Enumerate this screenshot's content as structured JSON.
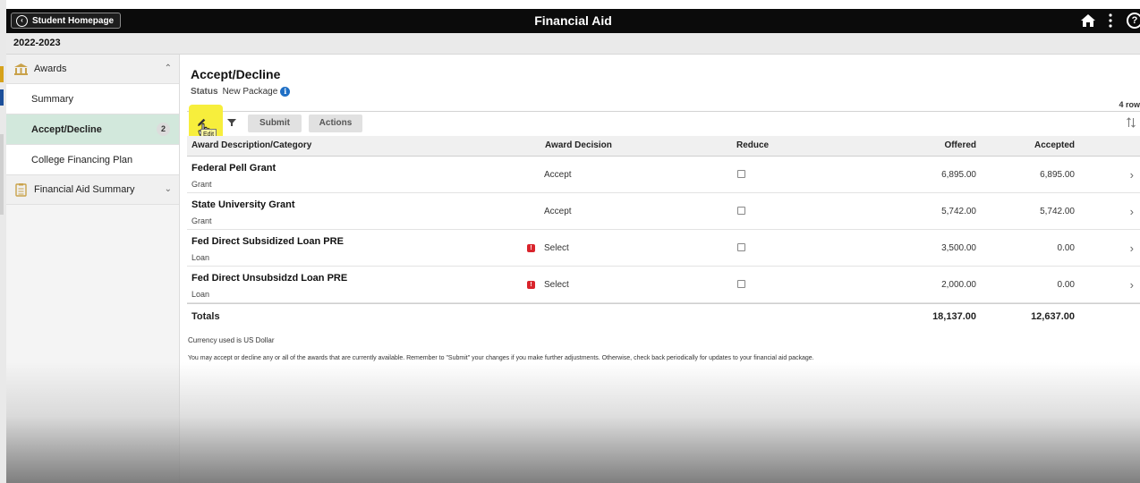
{
  "topbar": {
    "home_label": "Student Homepage",
    "title": "Financial Aid",
    "help_glyph": "?"
  },
  "year": "2022-2023",
  "sidebar": {
    "items": [
      {
        "label": "Awards",
        "icon": "bank-icon"
      },
      {
        "label": "Summary"
      },
      {
        "label": "Accept/Decline",
        "badge": "2"
      },
      {
        "label": "College Financing Plan"
      },
      {
        "label": "Financial Aid Summary",
        "icon": "clipboard-icon"
      }
    ]
  },
  "main": {
    "title": "Accept/Decline",
    "status_label": "Status",
    "status_value": "New Package",
    "row_count": "4 row",
    "toolbar": {
      "submit_label": "Submit",
      "actions_label": "Actions",
      "edit_tooltip": "Edit"
    },
    "columns": {
      "description": "Award Description/Category",
      "decision": "Award Decision",
      "reduce": "Reduce",
      "offered": "Offered",
      "accepted": "Accepted"
    },
    "rows": [
      {
        "title": "Federal Pell Grant",
        "category": "Grant",
        "decision": "Accept",
        "offered": "6,895.00",
        "accepted": "6,895.00",
        "warning": false
      },
      {
        "title": "State University Grant",
        "category": "Grant",
        "decision": "Accept",
        "offered": "5,742.00",
        "accepted": "5,742.00",
        "warning": false
      },
      {
        "title": "Fed Direct Subsidized Loan PRE",
        "category": "Loan",
        "decision": "Select",
        "offered": "3,500.00",
        "accepted": "0.00",
        "warning": true
      },
      {
        "title": "Fed Direct Unsubsidzd Loan PRE",
        "category": "Loan",
        "decision": "Select",
        "offered": "2,000.00",
        "accepted": "0.00",
        "warning": true
      }
    ],
    "totals": {
      "label": "Totals",
      "offered": "18,137.00",
      "accepted": "12,637.00"
    },
    "currency_note": "Currency used is US Dollar",
    "instructions": "You may accept or decline any or all of the awards that are currently available. Remember to \"Submit\" your changes if you make further adjustments. Otherwise, check back periodically for updates to your financial aid package."
  },
  "colors": {
    "topbar": "#0b0b0b",
    "active_nav": "#d2e8dc",
    "highlight": "#f7ee3c",
    "info": "#1f6fc5",
    "warning": "#d9242c"
  }
}
